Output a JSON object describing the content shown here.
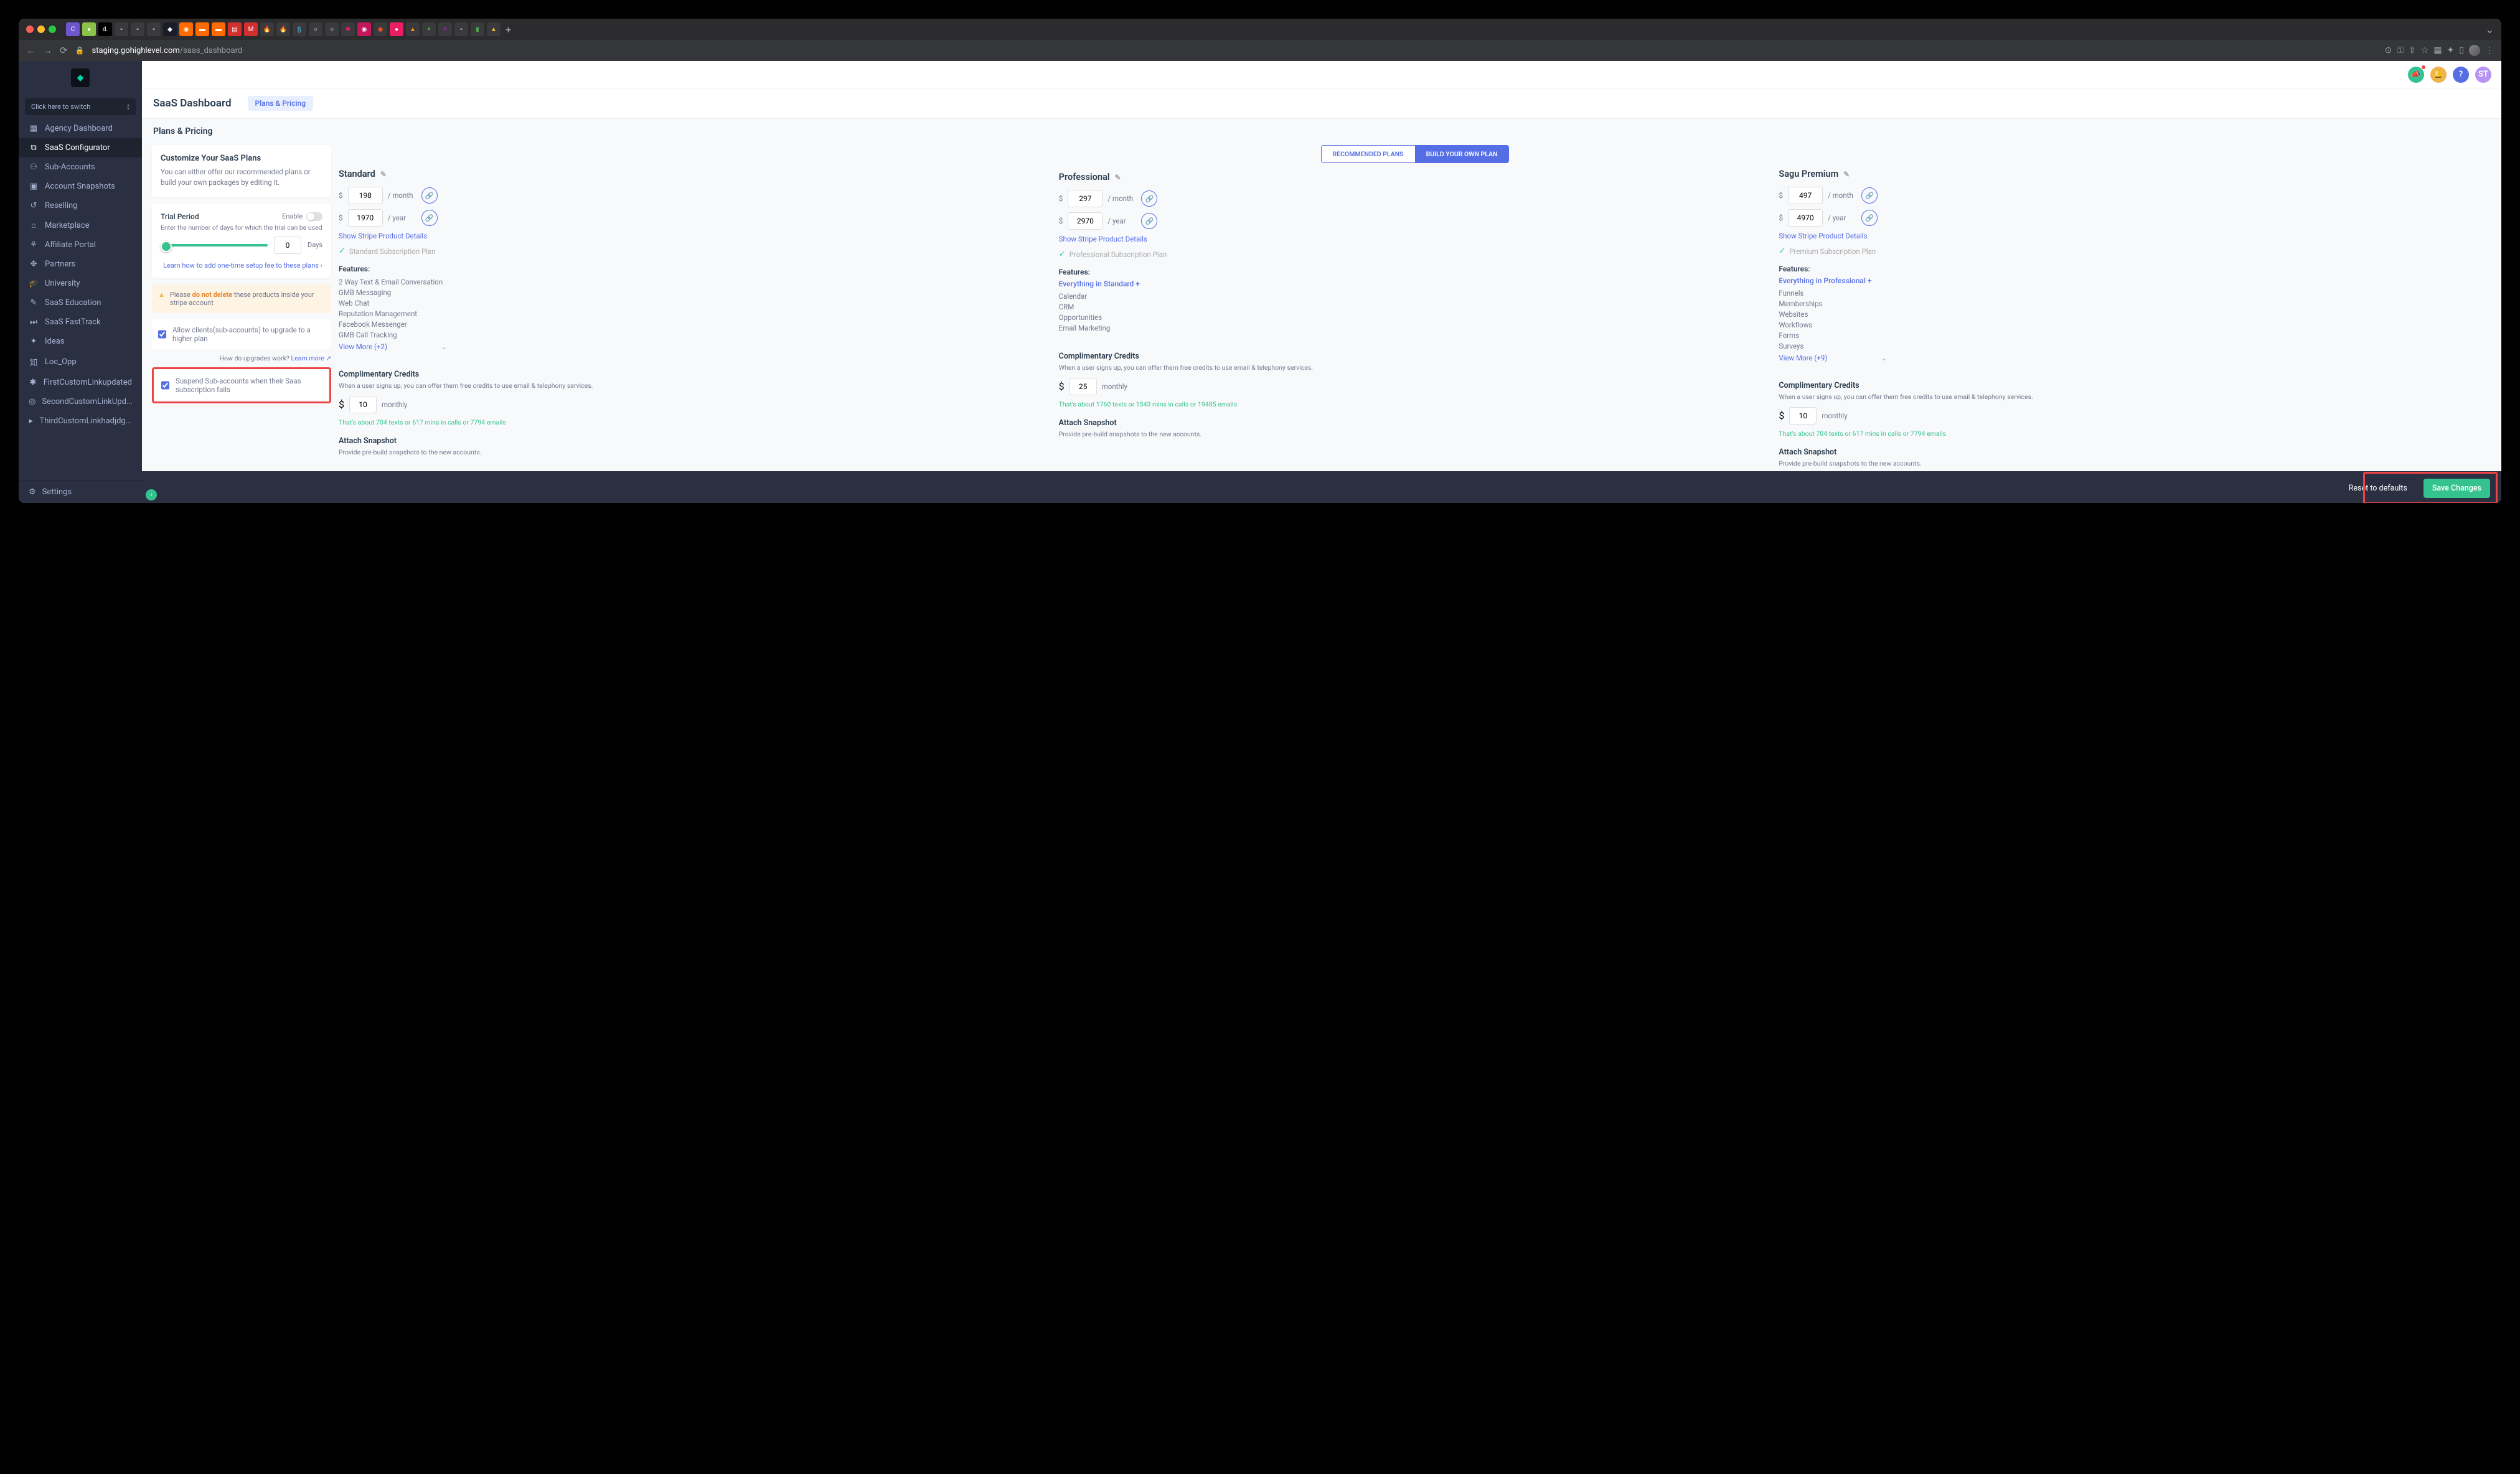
{
  "browser": {
    "url_host": "staging.gohighlevel.com",
    "url_path": "/saas_dashboard"
  },
  "sidebar": {
    "switcher": "Click here to switch",
    "items": [
      {
        "icon": "▦",
        "label": "Agency Dashboard"
      },
      {
        "icon": "⧉",
        "label": "SaaS Configurator",
        "active": true
      },
      {
        "icon": "⚇",
        "label": "Sub-Accounts"
      },
      {
        "icon": "▣",
        "label": "Account Snapshots"
      },
      {
        "icon": "↺",
        "label": "Reselling"
      },
      {
        "icon": "⌂",
        "label": "Marketplace"
      },
      {
        "icon": "⚘",
        "label": "Affiliate Portal"
      },
      {
        "icon": "✥",
        "label": "Partners"
      },
      {
        "icon": "🎓",
        "label": "University"
      },
      {
        "icon": "✎",
        "label": "SaaS Education"
      },
      {
        "icon": "⏭",
        "label": "SaaS FastTrack"
      },
      {
        "icon": "✦",
        "label": "Ideas"
      },
      {
        "icon": "知",
        "label": "Loc_Opp"
      },
      {
        "icon": "✱",
        "label": "FirstCustomLinkupdated"
      },
      {
        "icon": "◎",
        "label": "SecondCustomLinkUpd..."
      },
      {
        "icon": "▸",
        "label": "ThirdCustomLinkhadjdg..."
      }
    ],
    "settings": "Settings"
  },
  "topbar": {
    "avatar": "ST"
  },
  "page": {
    "title": "SaaS Dashboard",
    "tab": "Plans & Pricing",
    "section": "Plans & Pricing"
  },
  "customize": {
    "heading": "Customize Your SaaS Plans",
    "desc": "You can either offer our recommended plans or build your own packages by editing it.",
    "trial_label": "Trial Period",
    "enable": "Enable",
    "trial_desc": "Enter the number of days for which the trial can be used",
    "trial_days": "0",
    "days": "Days",
    "learn": "Learn how to add one-time setup fee to these plans",
    "warn_prefix": "Please ",
    "warn_bold": "do not delete",
    "warn_suffix": " these products inside your stripe account",
    "allow_upgrade": "Allow clients(sub-accounts) to upgrade to a higher plan",
    "how_upgrades": "How do upgrades work? ",
    "how_upgrades_link": "Learn more",
    "suspend": "Suspend Sub-accounts when their Saas subscription fails"
  },
  "tabs": {
    "rec": "RECOMMENDED PLANS",
    "byo": "BUILD YOUR OWN PLAN"
  },
  "plans": [
    {
      "name": "Standard",
      "month": "198",
      "year": "1970",
      "stripe": "Show Stripe Product Details",
      "subplan": "Standard Subscription Plan",
      "features_head": "Features:",
      "inherit": "",
      "features": [
        "2 Way Text & Email Conversation",
        "GMB Messaging",
        "Web Chat",
        "Reputation Management",
        "Facebook Messenger",
        "GMB Call Tracking"
      ],
      "viewmore": "View More (+2)",
      "comp_head": "Complimentary Credits",
      "comp_desc": "When a user signs up, you can offer them free credits to use email & telephony services.",
      "credits": "10",
      "monthly": "monthly",
      "about": "That's about 704 texts or 617 mins in calls or 7794 emails",
      "snap_head": "Attach Snapshot",
      "snap_desc": "Provide pre-build snapshots to the new accounts."
    },
    {
      "name": "Professional",
      "month": "297",
      "year": "2970",
      "stripe": "Show Stripe Product Details",
      "subplan": "Professional Subscription Plan",
      "features_head": "Features:",
      "inherit": "Everything in Standard +",
      "features": [
        "Calendar",
        "CRM",
        "Opportunities",
        "Email Marketing"
      ],
      "viewmore": "",
      "comp_head": "Complimentary Credits",
      "comp_desc": "When a user signs up, you can offer them free credits to use email & telephony services.",
      "credits": "25",
      "monthly": "monthly",
      "about": "That's about 1760 texts or 1543 mins in calls or 19485 emails",
      "snap_head": "Attach Snapshot",
      "snap_desc": "Provide pre-build snapshots to the new accounts."
    },
    {
      "name": "Sagu Premium",
      "month": "497",
      "year": "4970",
      "stripe": "Show Stripe Product Details",
      "subplan": "Premium Subscription Plan",
      "features_head": "Features:",
      "inherit": "Everything in Professional +",
      "features": [
        "Funnels",
        "Memberships",
        "Websites",
        "Workflows",
        "Forms",
        "Surveys"
      ],
      "viewmore": "View More (+9)",
      "comp_head": "Complimentary Credits",
      "comp_desc": "When a user signs up, you can offer them free credits to use email & telephony services.",
      "credits": "10",
      "monthly": "monthly",
      "about": "That's about 704 texts or 617 mins in calls or 7794 emails",
      "snap_head": "Attach Snapshot",
      "snap_desc": "Provide pre-build snapshots to the new accounts."
    }
  ],
  "per_month": "/ month",
  "per_year": "/ year",
  "footer": {
    "reset": "Reset to defaults",
    "save": "Save Changes"
  }
}
